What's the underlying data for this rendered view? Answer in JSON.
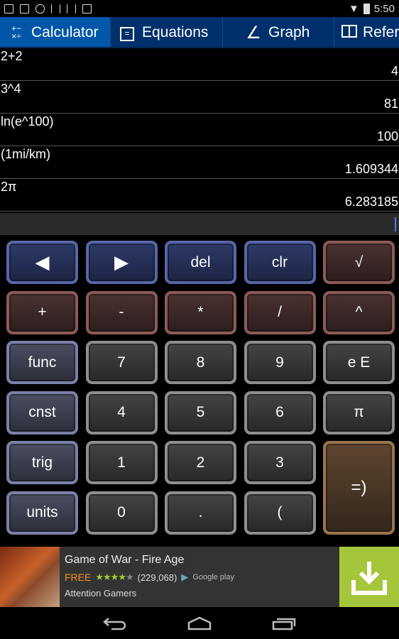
{
  "status": {
    "time": "5:50",
    "icons": [
      "download-icon",
      "image-icon",
      "cloud-upload-icon",
      "barcode-icon",
      "barcode-icon",
      "shopping-bag-icon"
    ],
    "right_icons": [
      "wifi-icon",
      "battery-charging-icon"
    ]
  },
  "tabs": [
    {
      "label": "Calculator",
      "icon": "calculator-icon",
      "glyph": "+−\n×÷",
      "active": true
    },
    {
      "label": "Equations",
      "icon": "equations-icon",
      "glyph": "☰",
      "active": false
    },
    {
      "label": "Graph",
      "icon": "graph-icon",
      "glyph": "∠",
      "active": false
    },
    {
      "label": "Reference",
      "icon": "book-icon",
      "glyph": "📖",
      "active": false
    }
  ],
  "history": [
    {
      "expr": "2+2",
      "result": "4"
    },
    {
      "expr": "3^4",
      "result": "81"
    },
    {
      "expr": "ln(e^100)",
      "result": "100"
    },
    {
      "expr": "(1mi/km)",
      "result": "1.609344"
    },
    {
      "expr": "2π",
      "result": "6.283185"
    }
  ],
  "input": {
    "value": ""
  },
  "colors": {
    "accent": "#0057a8",
    "cursor": "#4a7ef0",
    "ad_download": "#a5c63b"
  },
  "keys": [
    {
      "label": "◀",
      "name": "cursor-left-key",
      "style": "blue"
    },
    {
      "label": "▶",
      "name": "cursor-right-key",
      "style": "blue"
    },
    {
      "label": "del",
      "name": "delete-key",
      "style": "blue"
    },
    {
      "label": "clr",
      "name": "clear-key",
      "style": "blue"
    },
    {
      "label": "√",
      "name": "sqrt-key",
      "style": "red"
    },
    {
      "label": "+",
      "name": "plus-key",
      "style": "red"
    },
    {
      "label": "-",
      "name": "minus-key",
      "style": "red"
    },
    {
      "label": "*",
      "name": "multiply-key",
      "style": "red"
    },
    {
      "label": "/",
      "name": "divide-key",
      "style": "red"
    },
    {
      "label": "^",
      "name": "power-key",
      "style": "red"
    },
    {
      "label": "func",
      "name": "func-key",
      "style": "slate"
    },
    {
      "label": "7",
      "name": "digit-7-key",
      "style": "gray"
    },
    {
      "label": "8",
      "name": "digit-8-key",
      "style": "gray"
    },
    {
      "label": "9",
      "name": "digit-9-key",
      "style": "gray"
    },
    {
      "label": "e E",
      "name": "exponent-key",
      "style": "gray"
    },
    {
      "label": "cnst",
      "name": "constants-key",
      "style": "slate"
    },
    {
      "label": "4",
      "name": "digit-4-key",
      "style": "gray"
    },
    {
      "label": "5",
      "name": "digit-5-key",
      "style": "gray"
    },
    {
      "label": "6",
      "name": "digit-6-key",
      "style": "gray"
    },
    {
      "label": "π",
      "name": "pi-key",
      "style": "gray"
    },
    {
      "label": "trig",
      "name": "trig-key",
      "style": "slate"
    },
    {
      "label": "1",
      "name": "digit-1-key",
      "style": "gray"
    },
    {
      "label": "2",
      "name": "digit-2-key",
      "style": "gray"
    },
    {
      "label": "3",
      "name": "digit-3-key",
      "style": "gray"
    },
    {
      "label": "=)",
      "name": "equals-key",
      "style": "equals"
    },
    {
      "label": "units",
      "name": "units-key",
      "style": "slate"
    },
    {
      "label": "0",
      "name": "digit-0-key",
      "style": "gray"
    },
    {
      "label": ".",
      "name": "decimal-key",
      "style": "gray"
    },
    {
      "label": "(",
      "name": "paren-key",
      "style": "gray"
    }
  ],
  "ad": {
    "title": "Game of War - Fire Age",
    "price": "FREE",
    "rating": 4,
    "rating_max": 5,
    "reviews": "(229,068)",
    "store": "Google play",
    "advertiser": "Attention Gamers"
  }
}
